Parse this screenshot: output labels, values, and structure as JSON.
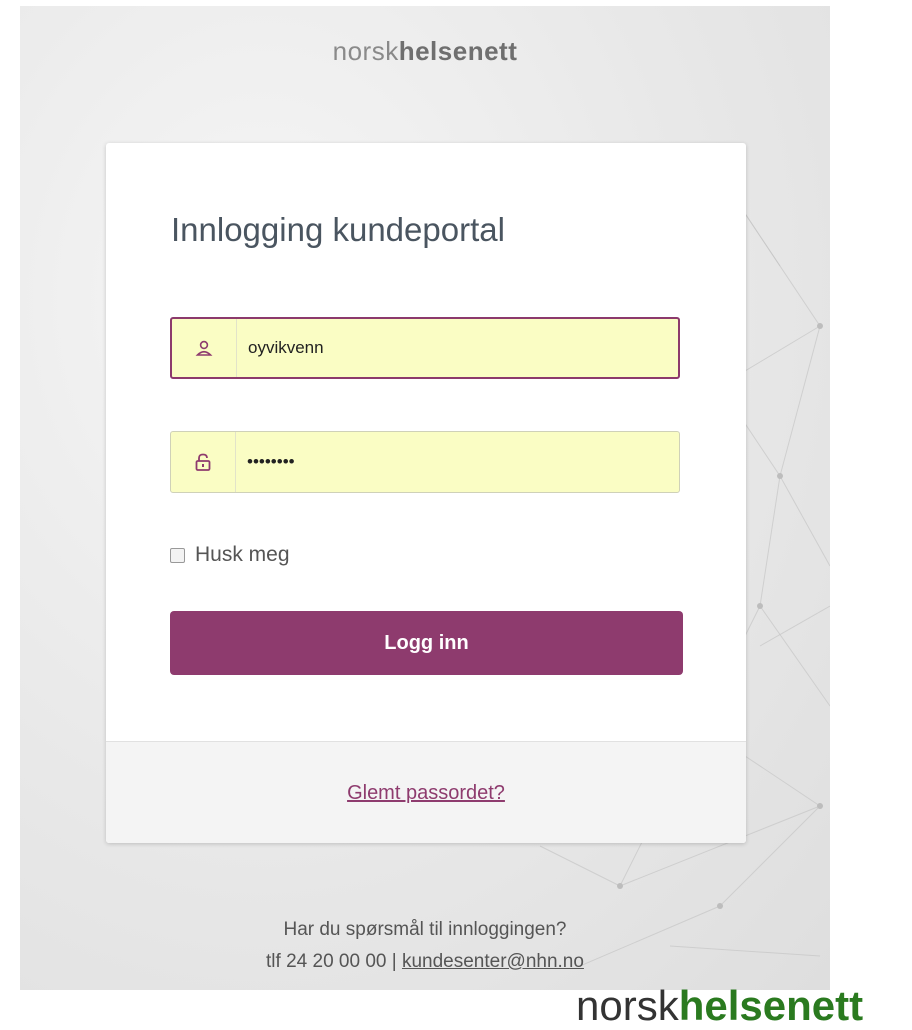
{
  "header": {
    "brand_light": "norsk",
    "brand_bold": "helsenett"
  },
  "login": {
    "title": "Innlogging kundeportal",
    "username_value": "oyvikvenn",
    "password_value": "••••••••",
    "remember_label": "Husk meg",
    "submit_label": "Logg inn",
    "forgot_label": "Glemt passordet?"
  },
  "help": {
    "question": "Har du spørsmål til innloggingen?",
    "phone": "tlf 24 20 00 00 | ",
    "email": "kundesenter@nhn.no"
  },
  "footer_logo": {
    "brand_light": "norsk",
    "brand_bold": "helsenett"
  },
  "colors": {
    "accent": "#8e3b6e",
    "autofill": "#fafdc4",
    "footer_brand": "#2a7a1f"
  },
  "icons": {
    "username": "user-icon",
    "password": "lock-icon"
  }
}
